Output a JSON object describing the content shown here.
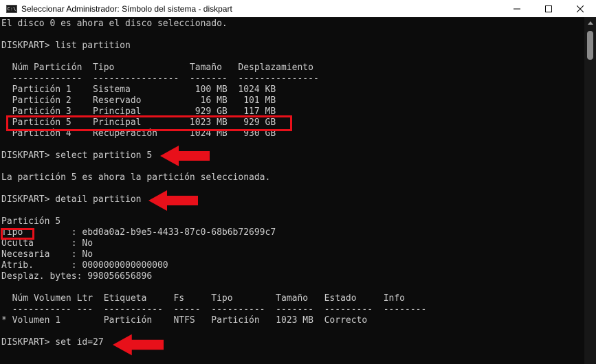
{
  "window": {
    "title": "Seleccionar Administrador: Símbolo del sistema - diskpart",
    "icon_label": "C:\\"
  },
  "colors": {
    "background": "#0c0c0c",
    "text": "#cccccc",
    "highlight": "#e8101a"
  },
  "console": {
    "lines": [
      "El disco 0 es ahora el disco seleccionado.",
      "",
      "DISKPART> list partition",
      "",
      "  Núm Partición  Tipo              Tamaño   Desplazamiento",
      "  -------------  ----------------  -------  ---------------",
      "  Partición 1    Sistema            100 MB  1024 KB",
      "  Partición 2    Reservado           16 MB   101 MB",
      "  Partición 3    Principal          929 GB   117 MB",
      "  Partición 5    Principal         1023 MB   929 GB",
      "  Partición 4    Recuperación      1024 MB   930 GB",
      "",
      "DISKPART> select partition 5",
      "",
      "La partición 5 es ahora la partición seleccionada.",
      "",
      "DISKPART> detail partition",
      "",
      "Partición 5",
      "Tipo         : ebd0a0a2-b9e5-4433-87c0-68b6b72699c7",
      "Oculta       : No",
      "Necesaria    : No",
      "Atrib.       : 0000000000000000",
      "Desplaz. bytes: 998056656896",
      "",
      "  Núm Volumen Ltr  Etiqueta     Fs     Tipo        Tamaño   Estado     Info",
      "  ----------- ---  -----------  -----  ----------  -------  ---------  --------",
      "* Volumen 1        Partición    NTFS   Partición   1023 MB  Correcto",
      "",
      "DISKPART> set id=27"
    ]
  }
}
